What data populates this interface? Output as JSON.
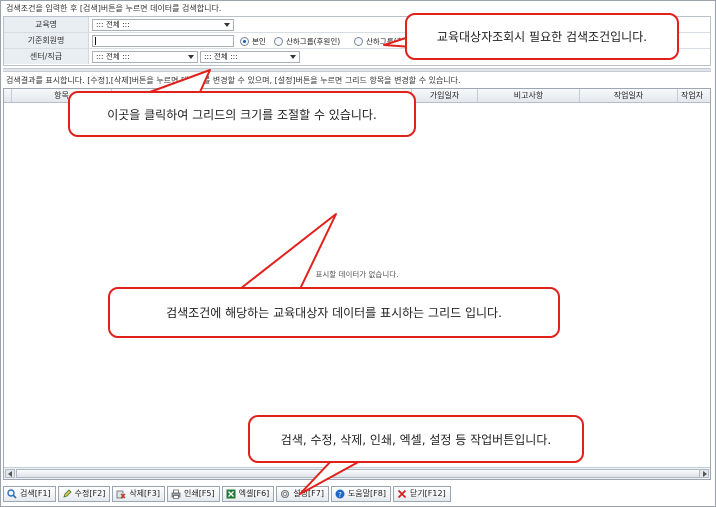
{
  "search_hint": "검색조건을 입력한 후 [검색]버튼을 누르면 데이터를 검색합니다.",
  "search": {
    "rows": [
      {
        "label": "교육명"
      },
      {
        "label": "기준회원명"
      },
      {
        "label": "센터/직급"
      }
    ],
    "course_select": "::: 전체 :::",
    "member_input": "",
    "radio_options": [
      {
        "label": "본인",
        "selected": true
      },
      {
        "label": "산하그룹(후원인)",
        "selected": false
      },
      {
        "label": "산하그룹(추천인)",
        "selected": false
      }
    ],
    "center_select": "::: 전체 :::",
    "rank_select": "::: 전체 :::"
  },
  "result_hint": "검색결과를 표시합니다. [수정],[삭제]버튼을 누르면 데이터를 변경할 수 있으며, [설정]버튼을 누르면 그리드 항목을 변경할 수 있습니다.",
  "grid": {
    "columns": [
      "항목",
      "가입일자",
      "비고사항",
      "작업일자",
      "작업자"
    ],
    "empty_message": "표시할 데이터가 없습니다."
  },
  "toolbar": [
    {
      "label": "검색[F1]",
      "icon": "search-icon",
      "color": "#2a6fb8"
    },
    {
      "label": "수정[F2]",
      "icon": "edit-icon",
      "color": "#3b7a3b"
    },
    {
      "label": "삭제[F3]",
      "icon": "delete-icon",
      "color": "#c0392b"
    },
    {
      "label": "인쇄[F5]",
      "icon": "print-icon",
      "color": "#555555"
    },
    {
      "label": "엑셀[F6]",
      "icon": "excel-icon",
      "color": "#1f7a3a"
    },
    {
      "label": "설정[F7]",
      "icon": "settings-icon",
      "color": "#666666"
    },
    {
      "label": "도움말[F8]",
      "icon": "help-icon",
      "color": "#1e66c8"
    },
    {
      "label": "닫기[F12]",
      "icon": "close-icon",
      "color": "#d0261f"
    }
  ],
  "callouts": {
    "search_conditions": "교육대상자조회시 필요한 검색조건입니다.",
    "resize": "이곳을 클릭하여 그리드의 크기를 조절할 수 있습니다.",
    "grid": "검색조건에 해당하는 교육대상자 데이터를 표시하는 그리드 입니다.",
    "buttons": "검색, 수정, 삭제, 인쇄, 엑셀, 설정 등 작업버튼입니다."
  },
  "colors": {
    "callout_border": "#e0211c",
    "label_bg": "#e9eef3"
  }
}
